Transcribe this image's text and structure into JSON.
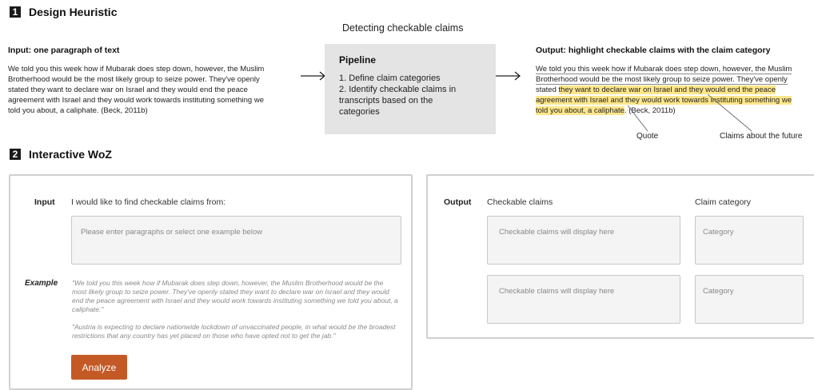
{
  "section1": {
    "number": "1",
    "title": "Design Heuristic",
    "center_title": "Detecting checkable claims",
    "input": {
      "heading": "Input: one paragraph of text",
      "lines": [
        "We told you this week how if Mubarak does step down, however, the Muslim",
        "Brotherhood would be the most likely group to seize power. They've openly",
        "stated they want to declare war on Israel and they would end the peace",
        "agreement with Israel and they would work towards instituting something we",
        "told you about, a caliphate. (Beck, 2011b)"
      ]
    },
    "pipeline": {
      "title": "Pipeline",
      "steps": [
        "1. Define claim categories",
        "2. Identify checkable claims in",
        "transcripts based on the",
        "categories"
      ]
    },
    "output": {
      "heading": "Output: highlight checkable claims with the claim category",
      "l1": "We told you this week how if Mubarak does step down, however, the Muslim",
      "l2": "Brotherhood would be the most likely group to seize power. They've openly",
      "l3a": "stated ",
      "l3b": "they want to declare war on Israel and they would end the peace",
      "l4": "agreement with Israel and they would work towards instituting something we",
      "l5a": "told you about, a caliphate",
      "l5b": ". (Beck, 2011b)",
      "label_quote": "Quote",
      "label_future": "Claims about the future"
    }
  },
  "section2": {
    "number": "2",
    "title": "Interactive WoZ",
    "input_panel": {
      "label": "Input",
      "prompt": "I would like to find checkable claims from:",
      "placeholder": "Please enter paragraphs or select one example below",
      "example_label": "Example",
      "example1": "\"We told you this week how if Mubarak does step down, however, the Muslim Brotherhood would be the most likely group to seize power. They've openly stated they want to declare war on Israel and they would end the peace agreement with Israel and they would work towards instituting something we told you about, a caliphate.\"",
      "example2": "\"Austria is expecting to declare nationwide lockdown of unvaccinated people, in what would be the broadest restrictions that any country has yet placed on those who have opted not to get the jab.\"",
      "analyze_label": "Analyze"
    },
    "output_panel": {
      "label": "Output",
      "col_claims": "Checkable claims",
      "col_category": "Claim category",
      "rows": [
        {
          "claim": "Checkable claims will display here",
          "category": "Category"
        },
        {
          "claim": "Checkable claims will display here",
          "category": "Category"
        }
      ]
    }
  }
}
